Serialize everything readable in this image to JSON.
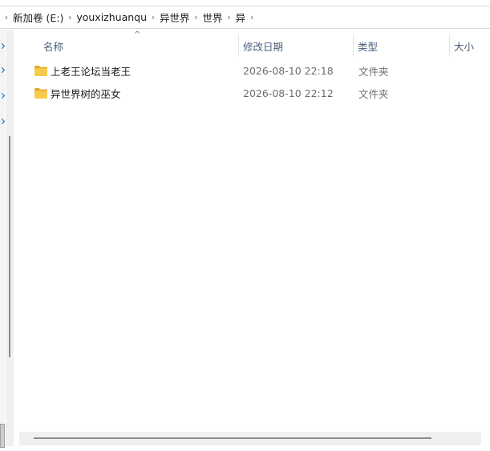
{
  "breadcrumb": {
    "items": [
      {
        "label": "新加卷 (E:)"
      },
      {
        "label": "youxizhuanqu"
      },
      {
        "label": "异世界"
      },
      {
        "label": "世界"
      },
      {
        "label": "异"
      }
    ]
  },
  "columns": {
    "name": "名称",
    "date_modified": "修改日期",
    "type": "类型",
    "size": "大小"
  },
  "files": [
    {
      "name": "上老王论坛当老王",
      "date_modified": "2026-08-10 22:18",
      "type": "文件夹",
      "icon": "folder-icon"
    },
    {
      "name": "异世界树的巫女",
      "date_modified": "2026-08-10 22:12",
      "type": "文件夹",
      "icon": "folder-icon"
    }
  ],
  "colors": {
    "folder": "#f7c94d",
    "folder_tab": "#e5a92b",
    "header_text": "#4c607a",
    "muted_text": "#6d6d6d",
    "nav_accent": "#0067c0"
  }
}
